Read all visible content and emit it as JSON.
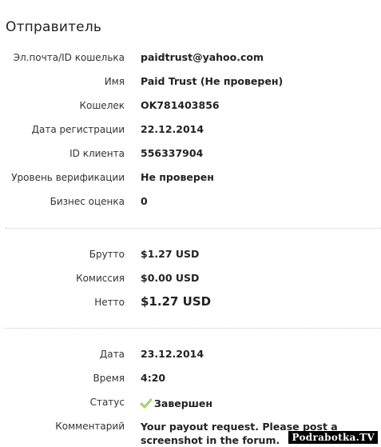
{
  "section_title": "Отправитель",
  "sender": {
    "email_label": "Эл.почта/ID кошелька",
    "email_value": "paidtrust@yahoo.com",
    "name_label": "Имя",
    "name_value": "Paid Trust (Не проверен)",
    "wallet_label": "Кошелек",
    "wallet_value": "OK781403856",
    "reg_label": "Дата регистрации",
    "reg_value": "22.12.2014",
    "client_label": "ID клиента",
    "client_value": "556337904",
    "verify_label": "Уровень верификации",
    "verify_value": "Не проверен",
    "rating_label": "Бизнес оценка",
    "rating_value": "0"
  },
  "amounts": {
    "gross_label": "Брутто",
    "gross_value": "$1.27 USD",
    "fee_label": "Комиссия",
    "fee_value": "$0.00 USD",
    "net_label": "Нетто",
    "net_value": "$1.27 USD"
  },
  "transaction": {
    "date_label": "Дата",
    "date_value": "23.12.2014",
    "time_label": "Время",
    "time_value": "4:20",
    "status_label": "Статус",
    "status_value": "Завершен",
    "status_icon": "checkmark-icon",
    "status_icon_color": "#8cc63f",
    "comment_label": "Комментарий",
    "comment_value": "Your payout request. Please post a screenshot in the forum."
  },
  "watermark": "Podrabotka.TV"
}
